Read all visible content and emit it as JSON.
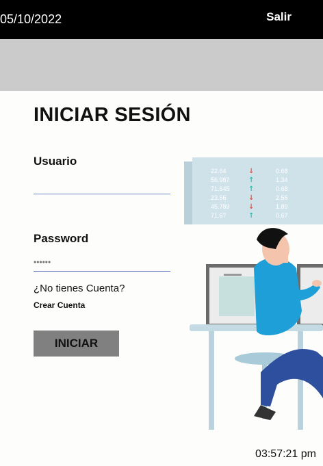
{
  "header": {
    "date": "05/10/2022",
    "logout_label": "Salir"
  },
  "login": {
    "title": "INICIAR SESIÓN",
    "username_label": "Usuario",
    "username_value": "",
    "password_label": "Password",
    "password_placeholder": "••••••",
    "no_account_text": "¿No tienes Cuenta?",
    "create_account_link": "Crear Cuenta",
    "submit_label": "INICIAR"
  },
  "illustration": {
    "screen_rows": [
      {
        "a": "22.64",
        "b": "0.68",
        "dir": "down"
      },
      {
        "a": "56.987",
        "b": "1.34",
        "dir": "up"
      },
      {
        "a": "71.645",
        "b": "0.68",
        "dir": "up"
      },
      {
        "a": "23.56",
        "b": "2.56",
        "dir": "down"
      },
      {
        "a": "45.789",
        "b": "1.89",
        "dir": "down"
      },
      {
        "a": "71.67",
        "b": "0.67",
        "dir": "up"
      }
    ],
    "colors": {
      "up": "#2bbfae",
      "down": "#e3563a",
      "shirt": "#1e9fd8",
      "pants": "#2e4e9e",
      "panel": "#cfe2ea"
    }
  },
  "footer": {
    "time": "03:57:21 pm"
  }
}
